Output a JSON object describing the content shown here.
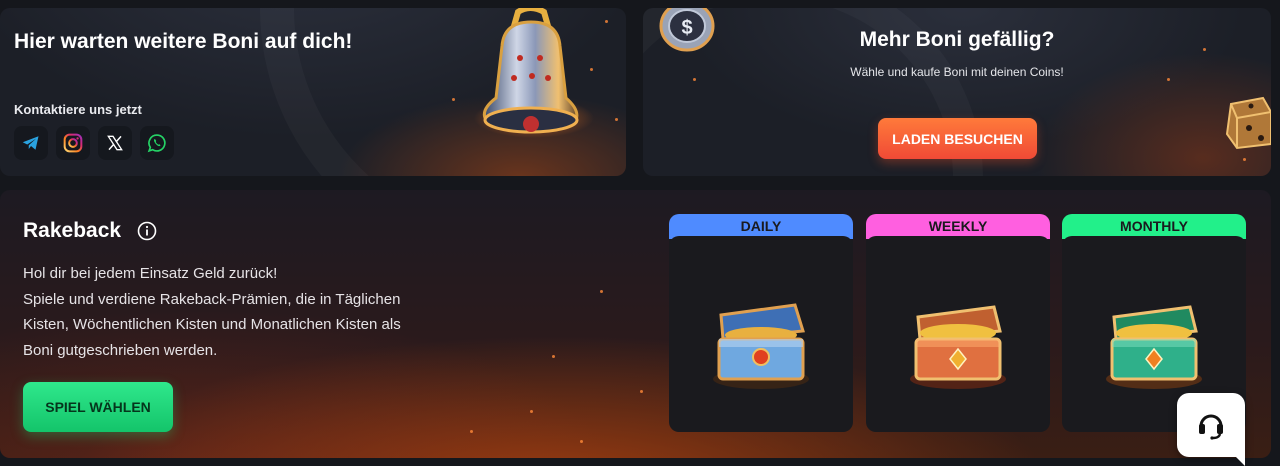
{
  "contact_card": {
    "title": "Hier warten weitere Boni auf dich!",
    "subtitle": "Kontaktiere uns jetzt",
    "socials": [
      {
        "name": "telegram-icon",
        "color": "#2aa3e0"
      },
      {
        "name": "instagram-icon",
        "color": "#e1306c"
      },
      {
        "name": "x-icon",
        "color": "#ffffff"
      },
      {
        "name": "whatsapp-icon",
        "color": "#25d366"
      }
    ]
  },
  "shop_card": {
    "title": "Mehr Boni gefällig?",
    "subtitle": "Wähle und kaufe Boni mit deinen Coins!",
    "button_label": "LADEN BESUCHEN",
    "button_color": "#f4573a"
  },
  "rakeback": {
    "title": "Rakeback",
    "description": [
      "Hol dir bei jedem Einsatz Geld zurück!",
      "Spiele und verdiene Rakeback-Prämien, die in Täglichen",
      "Kisten, Wöchentlichen Kisten und Monatlichen Kisten als",
      "Boni gutgeschrieben werden."
    ],
    "button_label": "SPIEL WÄHLEN",
    "button_color": "#1fd97a",
    "chests": [
      {
        "label": "DAILY",
        "color": "#4f8bff"
      },
      {
        "label": "WEEKLY",
        "color": "#ff5fe0"
      },
      {
        "label": "MONTHLY",
        "color": "#22f08a"
      }
    ]
  },
  "support": {
    "icon": "headset-icon"
  }
}
